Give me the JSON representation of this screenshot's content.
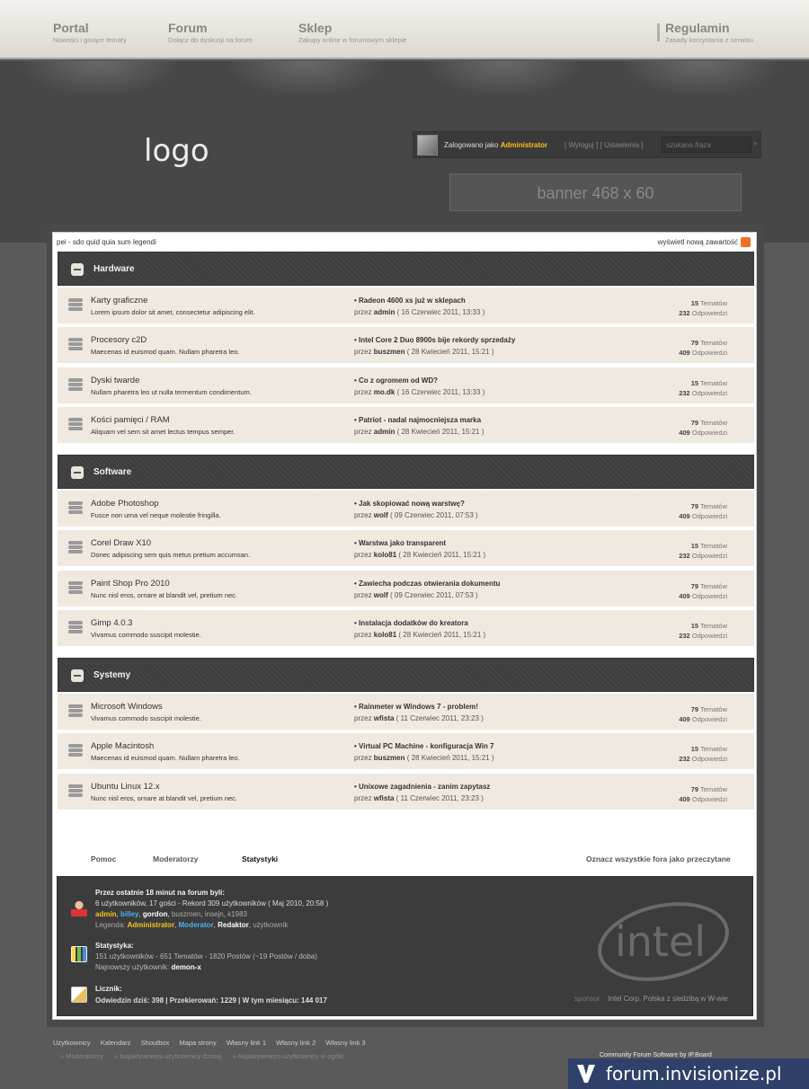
{
  "nav": {
    "items": [
      {
        "label": "Portal",
        "sub": "Nowości i gorące tematy"
      },
      {
        "label": "Forum",
        "sub": "Dołącz do dyskusji na forum"
      },
      {
        "label": "Sklep",
        "sub": "Zakupy online w forumowym sklepie"
      },
      {
        "label": "Regulamin",
        "sub": "Zasady korzystania z serwisu"
      }
    ]
  },
  "header": {
    "logo": "logo",
    "logged_prefix": "Zalogowano jako",
    "username": "Administrator",
    "links": "[ Wyloguj ]   [ Ustawienia ]",
    "search_placeholder": "szukana fraza",
    "search_clear": "»",
    "banner": "banner 468 x 60"
  },
  "topbar": {
    "breadcrumb": "pei                         - sdo quid quia sum legendi",
    "new_content": "wyświetl nową zawartość"
  },
  "categories": [
    {
      "title": "Hardware",
      "forums": [
        {
          "name": "Karty graficzne",
          "desc": "Lorem ipsum dolor sit amet, consectetur adipiscing elit.",
          "last_title": "• Radeon 4600 xs już w sklepach",
          "by": "przez",
          "author": "admin",
          "date": "( 16 Czerwiec 2011, 13:33 )",
          "topics": "15",
          "topics_label": "Tematów",
          "replies": "232",
          "replies_label": "Odpowiedzi"
        },
        {
          "name": "Procesory c2D",
          "desc": "Maecenas id euismod quam. Nullam pharetra leo.",
          "last_title": "• Intel Core 2 Duo 8900s bije rekordy sprzedaży",
          "by": "przez",
          "author": "buszmen",
          "date": "( 28 Kwiecień 2011, 15:21 )",
          "topics": "79",
          "topics_label": "Tematów",
          "replies": "409",
          "replies_label": "Odpowiedzi"
        },
        {
          "name": "Dyski twarde",
          "desc": "Nullam pharetra leo ut nulla termentum condimentum.",
          "last_title": "• Co z ogromem od WD?",
          "by": "przez",
          "author": "mo.dk",
          "date": "( 16 Czerwiec 2011, 13:33 )",
          "topics": "15",
          "topics_label": "Tematów",
          "replies": "232",
          "replies_label": "Odpowiedzi"
        },
        {
          "name": "Kości pamięci / RAM",
          "desc": "Aliquam vel sem sit amet lectus tempus semper.",
          "last_title": "• Patriot - nadal najmocniejsza marka",
          "by": "przez",
          "author": "admin",
          "date": "( 28 Kwiecień 2011, 15:21 )",
          "topics": "79",
          "topics_label": "Tematów",
          "replies": "409",
          "replies_label": "Odpowiedzi"
        }
      ]
    },
    {
      "title": "Software",
      "forums": [
        {
          "name": "Adobe Photoshop",
          "desc": "Fusce non urna vel neque molestie fringilla.",
          "last_title": "• Jak skopiować nową warstwę?",
          "by": "przez",
          "author": "wolf",
          "date": "( 09 Czerwiec 2011, 07:53 )",
          "topics": "79",
          "topics_label": "Tematów",
          "replies": "409",
          "replies_label": "Odpowiedzi"
        },
        {
          "name": "Corel Draw X10",
          "desc": "Donec adipiscing sem quis metus pretium accumsan.",
          "last_title": "• Warstwa jako transparent",
          "by": "przez",
          "author": "kolo81",
          "date": "( 28 Kwiecień 2011, 15:21 )",
          "topics": "15",
          "topics_label": "Tematów",
          "replies": "232",
          "replies_label": "Odpowiedzi"
        },
        {
          "name": "Paint Shop Pro 2010",
          "desc": "Nunc nisl eros, ornare at blandit vel, pretium nec.",
          "last_title": "• Zawiecha podczas otwierania dokumentu",
          "by": "przez",
          "author": "wolf",
          "date": "( 09 Czerwiec 2011, 07:53 )",
          "topics": "79",
          "topics_label": "Tematów",
          "replies": "409",
          "replies_label": "Odpowiedzi"
        },
        {
          "name": "Gimp 4.0.3",
          "desc": "Vivamus commodo suscipit molestie.",
          "last_title": "• Instalacja dodatków do kreatora",
          "by": "przez",
          "author": "kolo81",
          "date": "( 28 Kwiecień 2011, 15:21 )",
          "topics": "15",
          "topics_label": "Tematów",
          "replies": "232",
          "replies_label": "Odpowiedzi"
        }
      ]
    },
    {
      "title": "Systemy",
      "forums": [
        {
          "name": "Microsoft Windows",
          "desc": "Vivamus commodo suscipit molestie.",
          "last_title": "• Rainmeter w Windows 7 - problem!",
          "by": "przez",
          "author": "wfista",
          "date": "( 11 Czerwiec 2011, 23:23 )",
          "topics": "79",
          "topics_label": "Tematów",
          "replies": "409",
          "replies_label": "Odpowiedzi"
        },
        {
          "name": "Apple Macintosh",
          "desc": "Maecenas id euismod quam. Nullam pharetra leo.",
          "last_title": "• Virtual PC Machine - konfiguracja Win 7",
          "by": "przez",
          "author": "buszmen",
          "date": "( 28 Kwiecień 2011, 15:21 )",
          "topics": "15",
          "topics_label": "Tematów",
          "replies": "232",
          "replies_label": "Odpowiedzi"
        },
        {
          "name": "Ubuntu Linux 12.x",
          "desc": "Nunc nisl eros, ornare at blandit vel, pretium nec.",
          "last_title": "• Unixowe zagadnienia - zanim zapytasz",
          "by": "przez",
          "author": "wfista",
          "date": "( 11 Czerwiec 2011, 23:23 )",
          "topics": "79",
          "topics_label": "Tematów",
          "replies": "409",
          "replies_label": "Odpowiedzi"
        }
      ]
    }
  ],
  "footer_tabs": {
    "help": "Pomoc",
    "moderators": "Moderatorzy",
    "stats": "Statystyki",
    "mark_read": "Oznacz wszystkie fora jako przeczytane"
  },
  "stats_box": {
    "online_title": "Przez ostatnie 18 minut na forum byli:",
    "online_line": "6 użytkowników, 17 gości - Rekord 309 użytkowników ( Maj 2010, 20:58 )",
    "online_users": [
      "admin",
      "billey",
      "gordon",
      "buszmen",
      "insejn",
      "k1983"
    ],
    "legend_label": "Legenda:",
    "legend_items": [
      "Administrator",
      "Moderator",
      "Redaktor",
      "użytkownik"
    ],
    "stats_title": "Statystyka:",
    "stats_line": "151 użytkowników - 651 Tematów - 1820 Postów (~19 Postów / doba)",
    "newest_label": "Najnowszy użytkownik:",
    "newest_user": "demon-x",
    "counter_title": "Licznik:",
    "counter_line": "Odwiedzin dziś: 398 | Przekierowań: 1229 | W tym miesiącu: 144 017",
    "sponsor_label": "sponsor",
    "sponsor_text": "Intel Corp. Polska z siedzibą w W-wie",
    "intel_logo": "intel"
  },
  "bottom": {
    "links": [
      "Użytkownicy",
      "Kalendarz",
      "Shoutbox",
      "Mapa strony",
      "Własny link 1",
      "Własny link 2",
      "Własny link 3"
    ],
    "links2": [
      "» Moderatorzy",
      "» Najaktywniejsi użytkownicy dzisiaj",
      "» Najaktywniejsi użytkownicy w ogóle"
    ],
    "ipb": "Community Forum Software by IP.Board",
    "watermark": "forum.invisionize.pl"
  },
  "colors": {
    "accent_yellow": "#f5c518",
    "moderator_blue": "#4ab4f0",
    "row_bg": "#efe9df"
  }
}
